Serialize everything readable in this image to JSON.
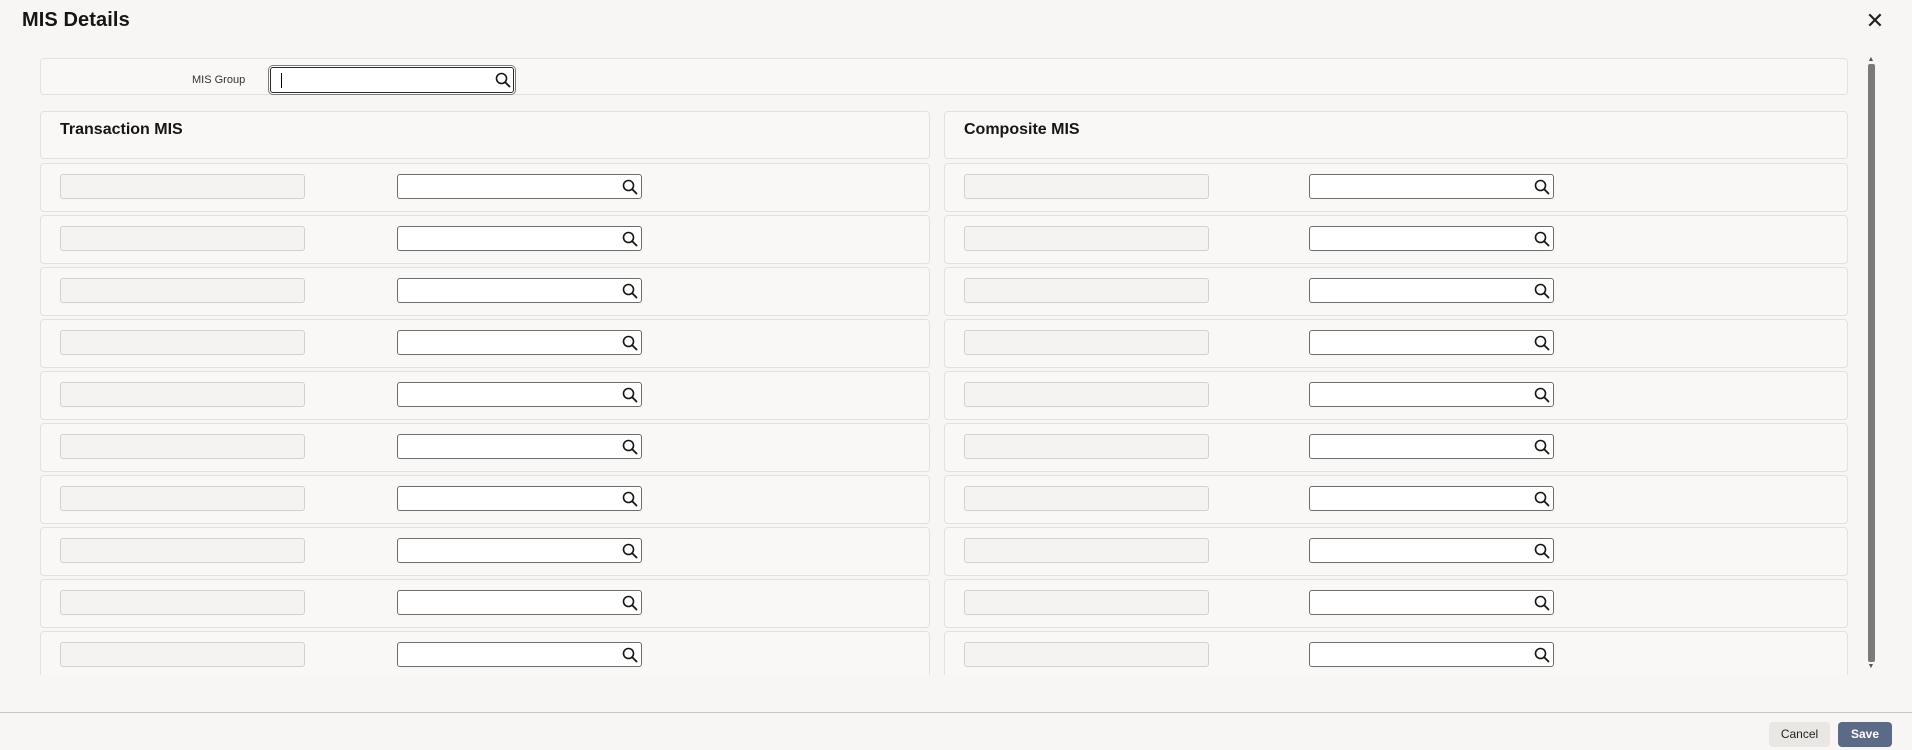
{
  "dialog": {
    "title": "MIS Details",
    "close_icon": "close-icon"
  },
  "mis_group": {
    "label": "MIS Group",
    "value": ""
  },
  "transaction_mis": {
    "title": "Transaction MIS",
    "rows": [
      {
        "name": "",
        "value": ""
      },
      {
        "name": "",
        "value": ""
      },
      {
        "name": "",
        "value": ""
      },
      {
        "name": "",
        "value": ""
      },
      {
        "name": "",
        "value": ""
      },
      {
        "name": "",
        "value": ""
      },
      {
        "name": "",
        "value": ""
      },
      {
        "name": "",
        "value": ""
      },
      {
        "name": "",
        "value": ""
      },
      {
        "name": "",
        "value": ""
      }
    ]
  },
  "composite_mis": {
    "title": "Composite MIS",
    "rows": [
      {
        "name": "",
        "value": ""
      },
      {
        "name": "",
        "value": ""
      },
      {
        "name": "",
        "value": ""
      },
      {
        "name": "",
        "value": ""
      },
      {
        "name": "",
        "value": ""
      },
      {
        "name": "",
        "value": ""
      },
      {
        "name": "",
        "value": ""
      },
      {
        "name": "",
        "value": ""
      },
      {
        "name": "",
        "value": ""
      },
      {
        "name": "",
        "value": ""
      }
    ]
  },
  "footer": {
    "cancel_label": "Cancel",
    "save_label": "Save"
  },
  "colors": {
    "primary_button": "#5b6a86",
    "background": "#f7f6f4"
  }
}
